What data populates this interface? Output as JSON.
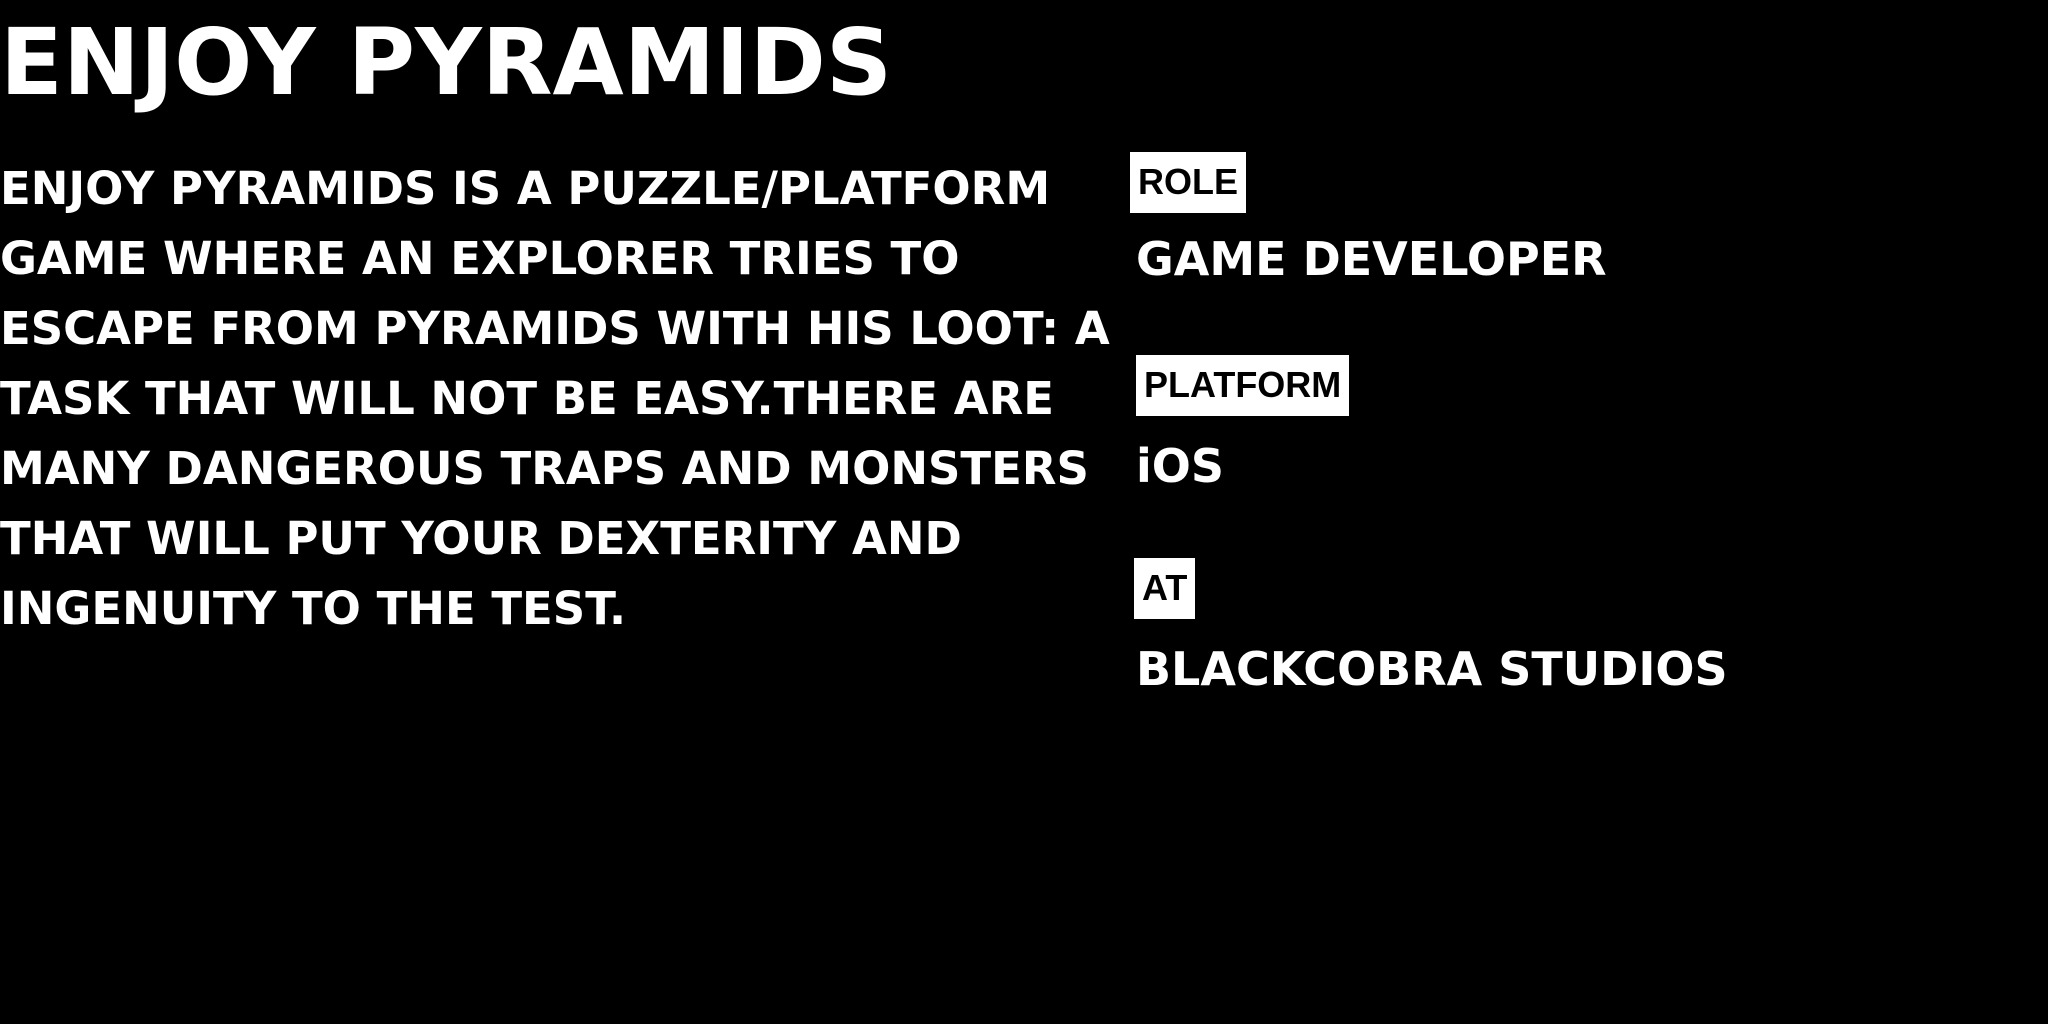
{
  "project": {
    "title": "ENJOY PYRAMIDS",
    "description_lines": [
      "ENJOY PYRAMIDS IS A PUZZLE/PLATFORM",
      "GAME WHERE AN EXPLORER TRIES TO",
      "ESCAPE FROM PYRAMIDS WITH HIS LOOT: A",
      "TASK THAT WILL NOT BE EASY.THERE ARE",
      "MANY DANGEROUS TRAPS AND MONSTERS",
      "THAT WILL PUT YOUR DEXTERITY AND",
      "INGENUITY TO THE TEST."
    ]
  },
  "details": {
    "role": {
      "label": "ROLE",
      "value": "GAME DEVELOPER"
    },
    "platform": {
      "label": "PLATFORM",
      "value": "iOS"
    },
    "at": {
      "label": "AT",
      "value": "BLACKCOBRA STUDIOS"
    }
  },
  "colors": {
    "background": "#000000",
    "text": "#ffffff",
    "label_background": "#ffffff",
    "label_text": "#000000"
  }
}
